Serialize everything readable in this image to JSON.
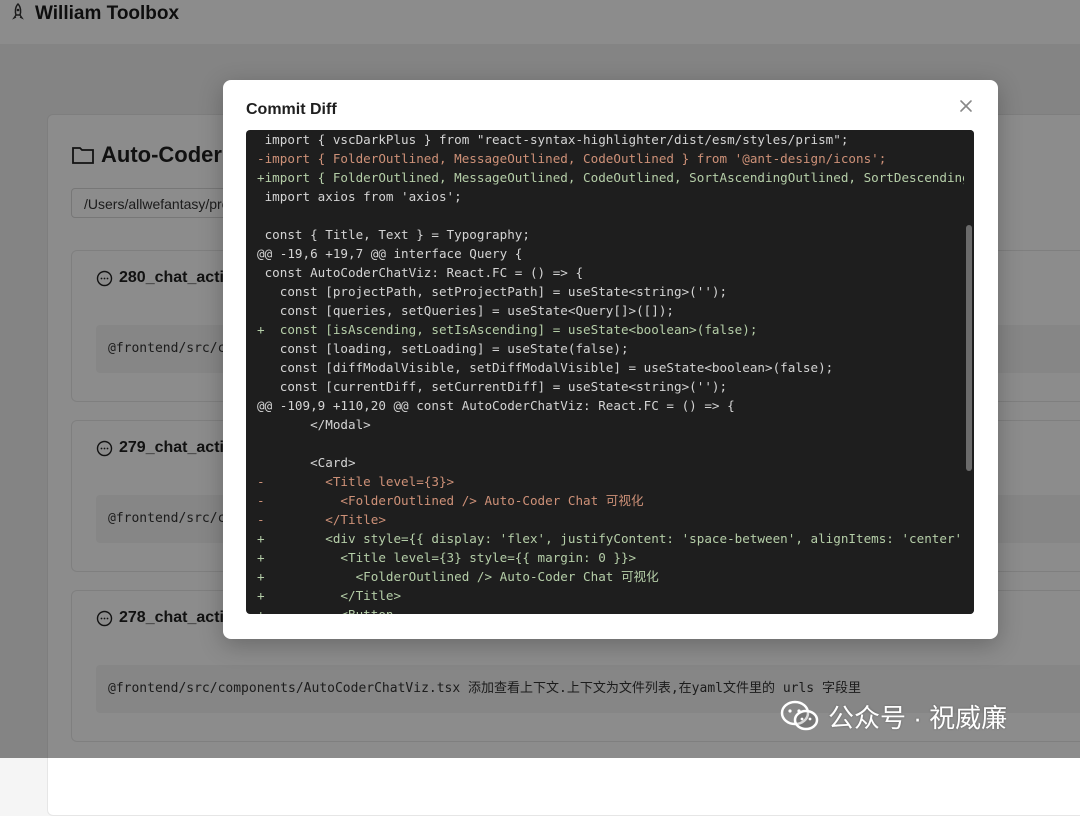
{
  "app": {
    "title": "William Toolbox",
    "logo_icon": "rocket-icon"
  },
  "background": {
    "card_title": "Auto-Coder",
    "path_value": "/Users/allwefantasy/pro",
    "queries": [
      {
        "title": "280_chat_acti",
        "body": "@frontend/src/c"
      },
      {
        "title": "279_chat_acti",
        "body": "@frontend/src/c"
      },
      {
        "title": "278_chat_acti",
        "body": "@frontend/src/components/AutoCoderChatViz.tsx 添加查看上下文.上下文为文件列表,在yaml文件里的 urls 字段里"
      }
    ]
  },
  "modal": {
    "title": "Commit Diff",
    "close_icon": "close-icon",
    "diff_lines": [
      {
        "type": "ctx",
        "text": " import { vscDarkPlus } from \"react-syntax-highlighter/dist/esm/styles/prism\";"
      },
      {
        "type": "del",
        "text": "-import { FolderOutlined, MessageOutlined, CodeOutlined } from '@ant-design/icons';"
      },
      {
        "type": "add",
        "text": "+import { FolderOutlined, MessageOutlined, CodeOutlined, SortAscendingOutlined, SortDescendingO"
      },
      {
        "type": "ctx",
        "text": " import axios from 'axios';"
      },
      {
        "type": "ctx",
        "text": ""
      },
      {
        "type": "ctx",
        "text": " const { Title, Text } = Typography;"
      },
      {
        "type": "hunk",
        "text": "@@ -19,6 +19,7 @@ interface Query {"
      },
      {
        "type": "ctx",
        "text": " const AutoCoderChatViz: React.FC = () => {"
      },
      {
        "type": "ctx",
        "text": "   const [projectPath, setProjectPath] = useState<string>('');"
      },
      {
        "type": "ctx",
        "text": "   const [queries, setQueries] = useState<Query[]>([]);"
      },
      {
        "type": "add",
        "text": "+  const [isAscending, setIsAscending] = useState<boolean>(false);"
      },
      {
        "type": "ctx",
        "text": "   const [loading, setLoading] = useState(false);"
      },
      {
        "type": "ctx",
        "text": "   const [diffModalVisible, setDiffModalVisible] = useState<boolean>(false);"
      },
      {
        "type": "ctx",
        "text": "   const [currentDiff, setCurrentDiff] = useState<string>('');"
      },
      {
        "type": "hunk",
        "text": "@@ -109,9 +110,20 @@ const AutoCoderChatViz: React.FC = () => {"
      },
      {
        "type": "ctx",
        "text": "       </Modal>"
      },
      {
        "type": "ctx",
        "text": ""
      },
      {
        "type": "ctx",
        "text": "       <Card>"
      },
      {
        "type": "del",
        "text": "-        <Title level={3}>"
      },
      {
        "type": "del",
        "text": "-          <FolderOutlined /> Auto-Coder Chat 可视化"
      },
      {
        "type": "del",
        "text": "-        </Title>"
      },
      {
        "type": "add",
        "text": "+        <div style={{ display: 'flex', justifyContent: 'space-between', alignItems: 'center',"
      },
      {
        "type": "add",
        "text": "+          <Title level={3} style={{ margin: 0 }}>"
      },
      {
        "type": "add",
        "text": "+            <FolderOutlined /> Auto-Coder Chat 可视化"
      },
      {
        "type": "add",
        "text": "+          </Title>"
      },
      {
        "type": "add",
        "text": "+          <Button"
      }
    ]
  },
  "watermark": {
    "text": "公众号 · 祝威廉",
    "icon": "wechat-icon"
  },
  "colors": {
    "add": "#b5cea8",
    "del": "#ce9178",
    "code_bg": "#1e1e1e"
  }
}
